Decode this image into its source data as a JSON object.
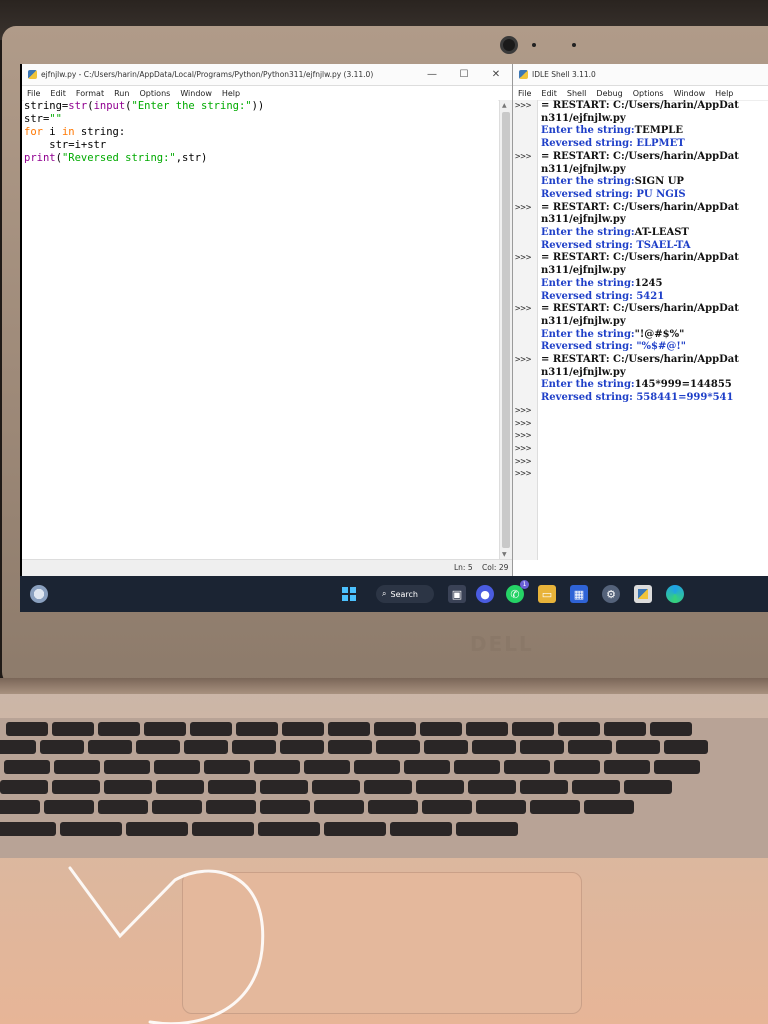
{
  "editor": {
    "title": "ejfnjlw.py - C:/Users/harin/AppData/Local/Programs/Python/Python311/ejfnjlw.py (3.11.0)",
    "menu": [
      "File",
      "Edit",
      "Format",
      "Run",
      "Options",
      "Window",
      "Help"
    ],
    "status": {
      "ln": "Ln: 5",
      "col": "Col: 29"
    }
  },
  "shell": {
    "title": "IDLE Shell 3.11.0",
    "menu": [
      "File",
      "Edit",
      "Shell",
      "Debug",
      "Options",
      "Window",
      "Help"
    ],
    "prompt": ">>>",
    "runs": [
      {
        "restart": "= RESTART: C:/Users/harin/AppDat",
        "path": "n311/ejfnjlw.py",
        "enter_label": "Enter the string:",
        "input": "TEMPLE",
        "rev_label": "Reversed string:",
        "output": " ELPMET"
      },
      {
        "restart": "= RESTART: C:/Users/harin/AppDat",
        "path": "n311/ejfnjlw.py",
        "enter_label": "Enter the string:",
        "input": "SIGN UP",
        "rev_label": "Reversed string:",
        "output": " PU NGIS"
      },
      {
        "restart": "= RESTART: C:/Users/harin/AppDat",
        "path": "n311/ejfnjlw.py",
        "enter_label": "Enter the string:",
        "input": "AT-LEAST",
        "rev_label": "Reversed string:",
        "output": " TSAEL-TA"
      },
      {
        "restart": "= RESTART: C:/Users/harin/AppDat",
        "path": "n311/ejfnjlw.py",
        "enter_label": "Enter the string:",
        "input": "1245",
        "rev_label": "Reversed string:",
        "output": " 5421"
      },
      {
        "restart": "= RESTART: C:/Users/harin/AppDat",
        "path": "n311/ejfnjlw.py",
        "enter_label": "Enter the string:",
        "input": "\"!@#$%\"",
        "rev_label": "Reversed string:",
        "output": " \"%$#@!\""
      },
      {
        "restart": "= RESTART: C:/Users/harin/AppDat",
        "path": "n311/ejfnjlw.py",
        "enter_label": "Enter the string:",
        "input": "145*999=144855",
        "rev_label": "Reversed string:",
        "output": " 558441=999*541"
      }
    ]
  },
  "taskbar": {
    "search_label": "Search",
    "whatsapp_badge": "1",
    "icons": [
      "weather-icon",
      "windows-start-icon",
      "search-icon",
      "task-view-icon",
      "chat-icon",
      "whatsapp-icon",
      "file-explorer-icon",
      "store-icon",
      "settings-icon",
      "python-idle-icon",
      "edge-icon"
    ]
  },
  "brand": "DELL",
  "colors": {
    "keyword": "#ff7700",
    "string": "#00aa00",
    "builtin": "#900090",
    "shell_output": "#1e3fc8",
    "taskbar": "#1b2433"
  }
}
